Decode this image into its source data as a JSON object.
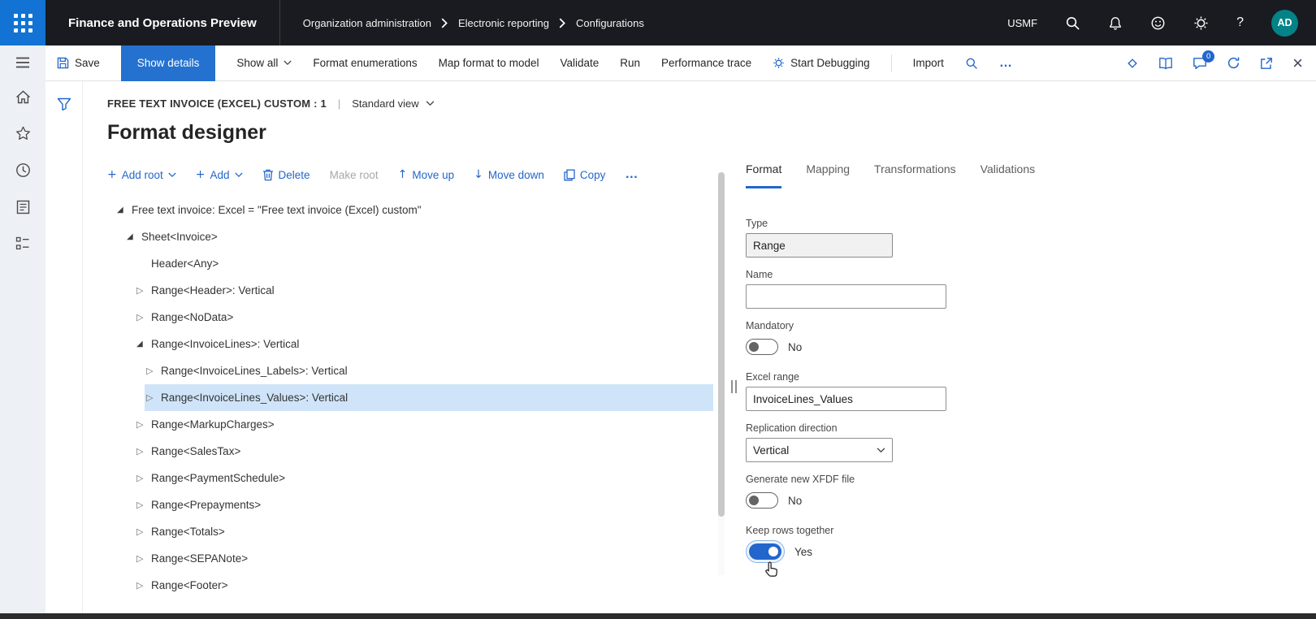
{
  "topbar": {
    "app_title": "Finance and Operations Preview",
    "breadcrumb": [
      "Organization administration",
      "Electronic reporting",
      "Configurations"
    ],
    "company": "USMF",
    "avatar_initials": "AD"
  },
  "command_bar": {
    "save": "Save",
    "show_details": "Show details",
    "show_all": "Show all",
    "items": [
      "Format enumerations",
      "Map format to model",
      "Validate",
      "Run",
      "Performance trace"
    ],
    "start_debugging": "Start Debugging",
    "import": "Import",
    "more": "…",
    "badge_count": "0"
  },
  "page": {
    "record_title": "FREE TEXT INVOICE (EXCEL) CUSTOM : 1",
    "divider": "|",
    "view_selector": "Standard view",
    "title": "Format designer"
  },
  "designer_toolbar": {
    "add_root": "Add root",
    "add": "Add",
    "delete": "Delete",
    "make_root": "Make root",
    "move_up": "Move up",
    "move_down": "Move down",
    "copy": "Copy",
    "more": "…"
  },
  "tree": {
    "items": [
      {
        "label": "Free text invoice: Excel = \"Free text invoice (Excel) custom\"",
        "indent": 0,
        "state": "expanded",
        "selected": false
      },
      {
        "label": "Sheet<Invoice>",
        "indent": 1,
        "state": "expanded",
        "selected": false
      },
      {
        "label": "Header<Any>",
        "indent": 2,
        "state": "leaf",
        "selected": false
      },
      {
        "label": "Range<Header>: Vertical",
        "indent": 2,
        "state": "collapsed",
        "selected": false
      },
      {
        "label": "Range<NoData>",
        "indent": 2,
        "state": "collapsed",
        "selected": false
      },
      {
        "label": "Range<InvoiceLines>: Vertical",
        "indent": 2,
        "state": "expanded",
        "selected": false
      },
      {
        "label": "Range<InvoiceLines_Labels>: Vertical",
        "indent": 3,
        "state": "collapsed",
        "selected": false
      },
      {
        "label": "Range<InvoiceLines_Values>: Vertical",
        "indent": 3,
        "state": "collapsed",
        "selected": true
      },
      {
        "label": "Range<MarkupCharges>",
        "indent": 2,
        "state": "collapsed",
        "selected": false
      },
      {
        "label": "Range<SalesTax>",
        "indent": 2,
        "state": "collapsed",
        "selected": false
      },
      {
        "label": "Range<PaymentSchedule>",
        "indent": 2,
        "state": "collapsed",
        "selected": false
      },
      {
        "label": "Range<Prepayments>",
        "indent": 2,
        "state": "collapsed",
        "selected": false
      },
      {
        "label": "Range<Totals>",
        "indent": 2,
        "state": "collapsed",
        "selected": false
      },
      {
        "label": "Range<SEPANote>",
        "indent": 2,
        "state": "collapsed",
        "selected": false
      },
      {
        "label": "Range<Footer>",
        "indent": 2,
        "state": "collapsed",
        "selected": false
      }
    ]
  },
  "properties": {
    "tabs": [
      {
        "label": "Format",
        "active": true
      },
      {
        "label": "Mapping",
        "active": false
      },
      {
        "label": "Transformations",
        "active": false
      },
      {
        "label": "Validations",
        "active": false
      }
    ],
    "fields": {
      "type": {
        "label": "Type",
        "value": "Range"
      },
      "name": {
        "label": "Name",
        "value": ""
      },
      "mandatory": {
        "label": "Mandatory",
        "value": "No"
      },
      "excel_range": {
        "label": "Excel range",
        "value": "InvoiceLines_Values"
      },
      "replication_direction": {
        "label": "Replication direction",
        "value": "Vertical"
      },
      "generate_xfdf": {
        "label": "Generate new XFDF file",
        "value": "No"
      },
      "keep_rows_together": {
        "label": "Keep rows together",
        "value": "Yes"
      }
    }
  },
  "icons": {
    "plus": "+",
    "move_up": "↑",
    "move_down": "↓",
    "tree_expanded": "◢",
    "tree_collapsed": "▷",
    "help": "?",
    "close": "×"
  },
  "colors": {
    "accent": "#2266cc",
    "show_details_bg": "#2471cf",
    "topbar_bg": "#191b20",
    "waffle_bg": "#1273d4",
    "selected_row": "#cfe4f8",
    "avatar_bg": "#038387",
    "toggle_on": "#2266cc"
  }
}
